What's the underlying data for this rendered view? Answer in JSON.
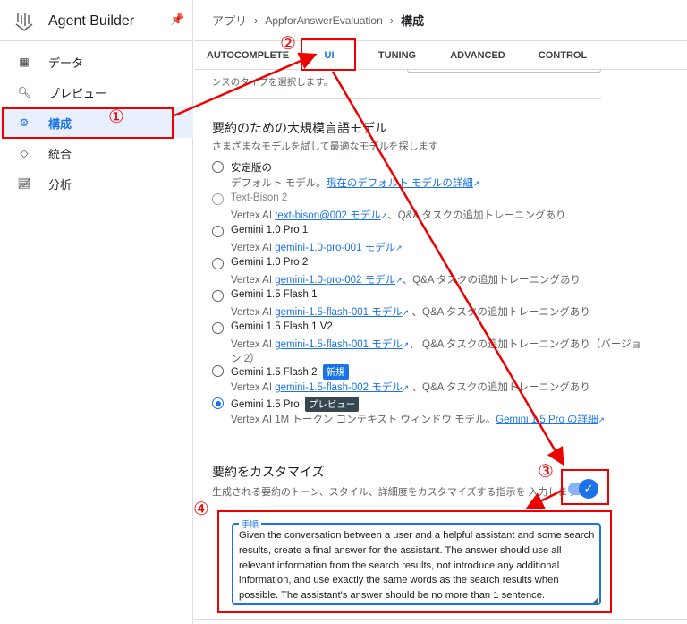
{
  "sidebar": {
    "title": "Agent Builder",
    "items": [
      {
        "label": "データ",
        "icon": "database-icon"
      },
      {
        "label": "プレビュー",
        "icon": "search-icon"
      },
      {
        "label": "構成",
        "icon": "gear-icon",
        "selected": true
      },
      {
        "label": "統合",
        "icon": "code-icon"
      },
      {
        "label": "分析",
        "icon": "analytics-icon"
      }
    ]
  },
  "breadcrumb": [
    "アプリ",
    "AppforAnswerEvaluation",
    "構成"
  ],
  "tabs": [
    "AUTOCOMPLETE",
    "UI",
    "TUNING",
    "ADVANCED",
    "CONTROL"
  ],
  "partial_text": "ンスのタイプを選択します。",
  "model_section": {
    "title": "要約のための大規模言語モデル",
    "subtitle": "さまざまなモデルを試して最適なモデルを探します",
    "options": [
      {
        "name": "安定版の",
        "pre": "デフォルト モデル。",
        "link": "現在のデフォルト モデルの詳細",
        "post": ""
      },
      {
        "name": "Text-Bison 2",
        "pre": "Vertex AI ",
        "link": "text-bison@002 モデル",
        "post": "、Q&A タスクの追加トレーニングあり",
        "disabled": true
      },
      {
        "name": "Gemini 1.0 Pro 1",
        "pre": "Vertex AI ",
        "link": "gemini-1.0-pro-001 モデル",
        "post": ""
      },
      {
        "name": "Gemini 1.0 Pro 2",
        "pre": "Vertex AI ",
        "link": "gemini-1.0-pro-002 モデル",
        "post": "、Q&A タスクの追加トレーニングあり"
      },
      {
        "name": "Gemini 1.5 Flash 1",
        "pre": "Vertex AI ",
        "link": "gemini-1.5-flash-001 モデル",
        "post": " 、Q&A タスクの追加トレーニングあり"
      },
      {
        "name": "Gemini 1.5 Flash 1 V2",
        "pre": "Vertex AI ",
        "link": "gemini-1.5-flash-001 モデル",
        "post": "、 Q&A タスクの追加トレーニングあり（バージョ",
        "post2": "ン 2）"
      },
      {
        "name": "Gemini 1.5 Flash 2",
        "badge": "新規",
        "pre": "Vertex AI ",
        "link": "gemini-1.5-flash-002 モデル",
        "post": " 、Q&A タスクの追加トレーニングあり"
      },
      {
        "name": "Gemini 1.5 Pro",
        "badge": "プレビュー",
        "pre": "Vertex AI 1M トークン コンテキスト ウィンドウ モデル。",
        "link": "Gemini 1.5 Pro の詳細",
        "post": "",
        "selected": true
      }
    ]
  },
  "customize": {
    "title": "要約をカスタマイズ",
    "subtitle": "生成される要約のトーン、スタイル、詳細度をカスタマイズする指示を 入力します",
    "toggle_on": true,
    "field_label": "手順",
    "field_value": "Given the conversation between a user and a helpful assistant and some search results, create a final answer for the assistant. The answer should use all relevant information from the search results, not introduce any additional information, and use exactly the same words as the search results when possible. The assistant's answer should be no more than 1 sentence."
  },
  "annotations": [
    "①",
    "②",
    "③",
    "④"
  ],
  "colors": {
    "accent": "#1a73e8",
    "annotation": "#ee0000",
    "preview_badge": "#37474f"
  }
}
